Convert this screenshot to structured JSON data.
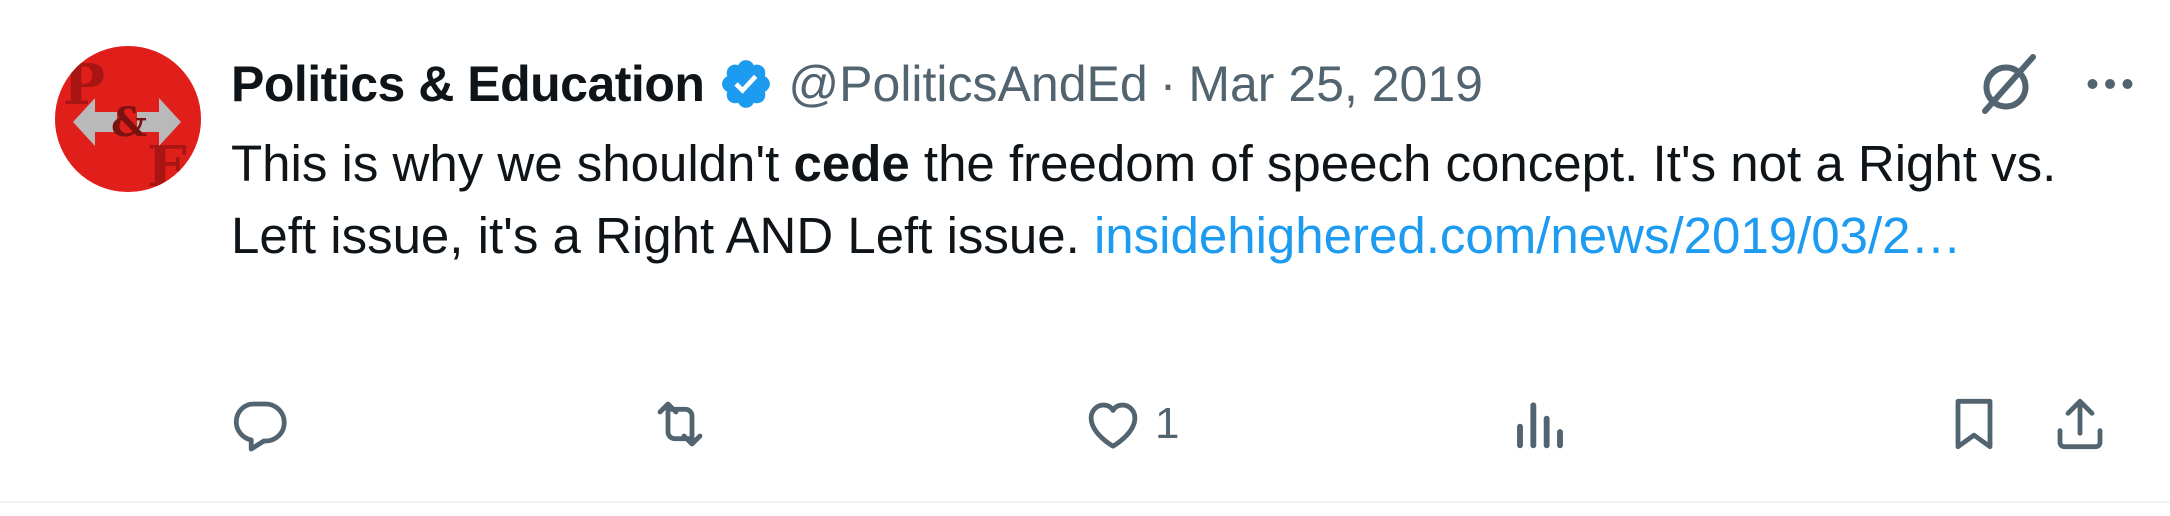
{
  "tweet": {
    "display_name": "Politics & Education",
    "handle": "@PoliticsAndEd",
    "separator": "·",
    "date": "Mar 25, 2019",
    "avatar_letters": {
      "top": "P",
      "middle": "&",
      "bottom": "F"
    },
    "text_part1": "This is why we shouldn't ",
    "text_bold": "cede",
    "text_part2": " the freedom of speech concept. It's not a Right vs. Left issue, it's a Right AND Left issue. ",
    "link_text": "insidehighered.com/news/2019/03/2…",
    "likes": "1"
  },
  "icons": {
    "verified": "verified-badge-icon",
    "grok": "grok-icon",
    "more": "more-dots-icon",
    "reply": "reply-icon",
    "retweet": "retweet-icon",
    "like": "like-icon",
    "views": "views-icon",
    "bookmark": "bookmark-icon",
    "share": "share-icon"
  },
  "colors": {
    "link": "#1d9bf0",
    "verified": "#1d9bf0",
    "secondary_text": "#536471",
    "primary_text": "#0f1419",
    "avatar_red": "#e8211d"
  }
}
